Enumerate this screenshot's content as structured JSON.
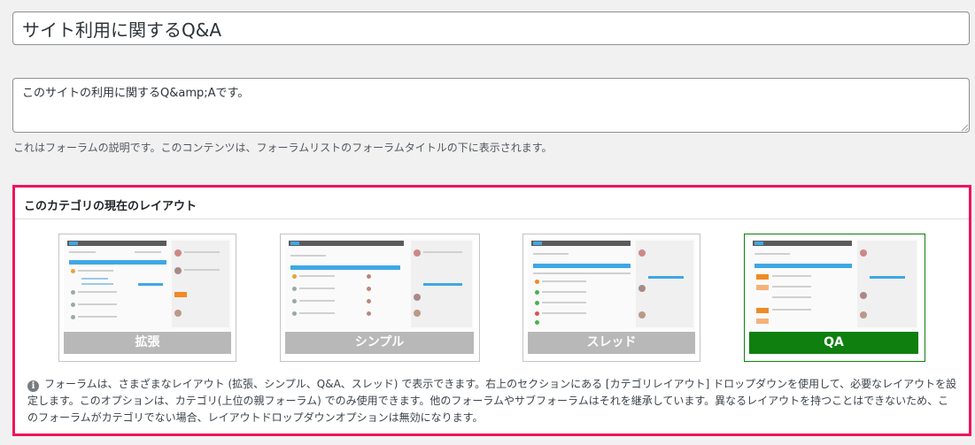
{
  "forum": {
    "title_value": "サイト利用に関するQ&A",
    "description_value": "このサイトの利用に関するQ&amp;Aです。",
    "description_help": "これはフォーラムの説明です。このコンテンツは、フォーラムリストのフォーラムタイトルの下に表示されます。"
  },
  "layout": {
    "heading": "このカテゴリの現在のレイアウト",
    "options": [
      {
        "label": "拡張",
        "selected": false
      },
      {
        "label": "シンプル",
        "selected": false
      },
      {
        "label": "スレッド",
        "selected": false
      },
      {
        "label": "QA",
        "selected": true
      }
    ],
    "info_icon": "info-icon",
    "note": "フォーラムは、さまざまなレイアウト (拡張、シンプル、Q&A、スレッド) で表示できます。右上のセクションにある [カテゴリレイアウト] ドロップダウンを使用して、必要なレイアウトを設定します。このオプションは、カテゴリ(上位の親フォーラム) でのみ使用できます。他のフォーラムやサブフォーラムはそれを継承しています。異なるレイアウトを持つことはできないため、このフォーラムがカテゴリでない場合、レイアウトドロップダウンオプションは無効になります。"
  },
  "colors": {
    "highlight_border": "#f0145a",
    "selected_green": "#0f7f0f",
    "unselected_gray": "#b8b8b8"
  }
}
